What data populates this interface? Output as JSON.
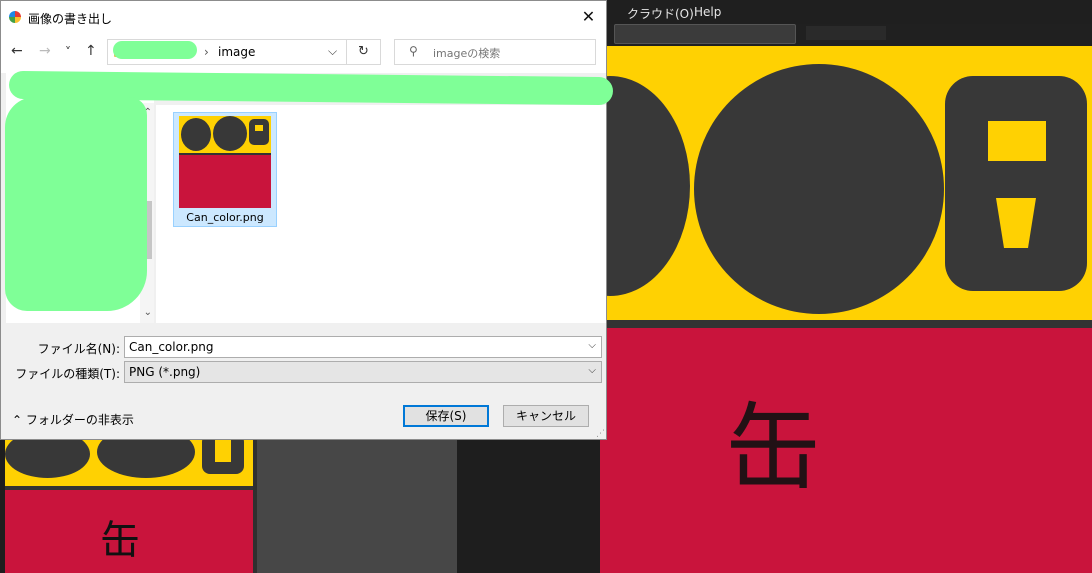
{
  "background_app": {
    "menus": [
      ")",
      "クラウド(O)",
      "Help"
    ],
    "canvas_text": "缶"
  },
  "dialog": {
    "title": "画像の書き出し",
    "close_glyph": "✕",
    "nav": {
      "back": "←",
      "forward": "→",
      "recent": "˅",
      "up": "↑"
    },
    "address": {
      "separator": "›",
      "current_folder": "image",
      "dropdown": "⌵",
      "refresh": "↻"
    },
    "search": {
      "icon": "⚲",
      "placeholder": "imageの検索"
    },
    "files": [
      {
        "name": "Can_color.png",
        "selected": true
      }
    ],
    "form": {
      "filename_label": "ファイル名(N):",
      "filename_value": "Can_color.png",
      "filetype_label": "ファイルの種類(T):",
      "filetype_value": "PNG (*.png)",
      "hide_folders": "フォルダーの非表示",
      "save": "保存(S)",
      "cancel": "キャンセル"
    }
  },
  "colors": {
    "yellow": "#ffd102",
    "red": "#c9143c",
    "dark_shape": "#383838",
    "redaction": "#7fff97",
    "selection": "#cce8ff",
    "focus": "#0078d7"
  }
}
